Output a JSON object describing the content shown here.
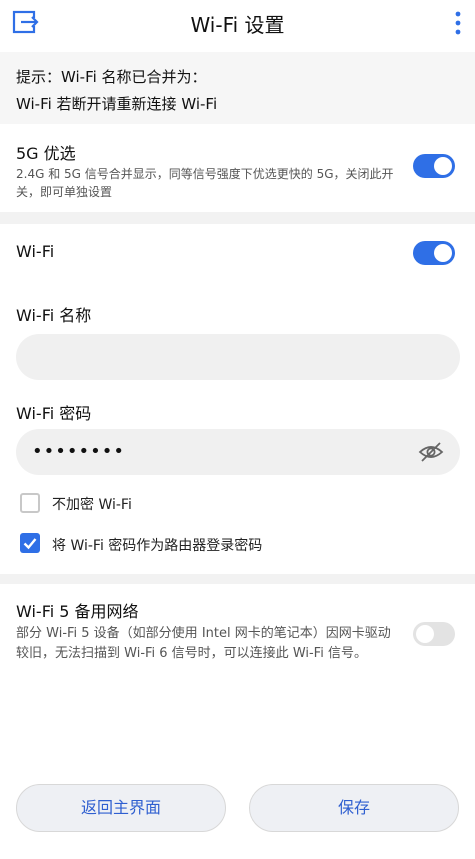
{
  "header": {
    "title": "Wi-Fi 设置",
    "back_icon": "exit-icon",
    "more_icon": "more-vertical-icon"
  },
  "hint": {
    "line1": "提示：Wi-Fi 名称已合并为：",
    "line2": "Wi-Fi 若断开请重新连接 Wi-Fi"
  },
  "pref5g": {
    "title": "5G 优选",
    "desc": "2.4G 和 5G 信号合并显示，同等信号强度下优选更快的 5G，关闭此开关，即可单独设置",
    "enabled": true
  },
  "wifi": {
    "label": "Wi-Fi",
    "enabled": true,
    "name_label": "Wi-Fi 名称",
    "name_value": "",
    "password_label": "Wi-Fi 密码",
    "password_value": "••••••••",
    "eye_icon": "eye-off-icon",
    "no_encrypt_label": "不加密 Wi-Fi",
    "no_encrypt_checked": false,
    "use_as_router_label": "将 Wi-Fi 密码作为路由器登录密码",
    "use_as_router_checked": true
  },
  "wifi5_backup": {
    "title": "Wi-Fi 5 备用网络",
    "desc": "部分 Wi-Fi 5 设备（如部分使用 Intel 网卡的笔记本）因网卡驱动较旧，无法扫描到 Wi-Fi 6 信号时，可以连接此 Wi-Fi 信号。",
    "enabled": false
  },
  "footer": {
    "back_label": "返回主界面",
    "save_label": "保存"
  },
  "colors": {
    "accent": "#2f6fe6",
    "button_text": "#2f5fd0"
  }
}
